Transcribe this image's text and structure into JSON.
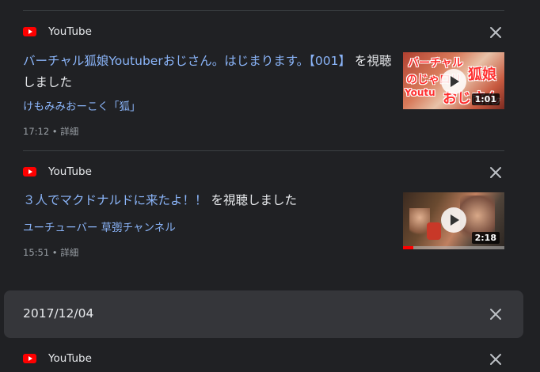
{
  "items": [
    {
      "source": "YouTube",
      "title_link": "バーチャル狐娘Youtuberおじさん。はじまります。【001】",
      "title_suffix": " を視聴しました",
      "channel": "けもみみおーこく「狐」",
      "time": "17:12",
      "separator": " • ",
      "detail_label": "詳細",
      "thumbnail": {
        "overlay_line1": "バーチャル",
        "overlay_line2": "のじゃロリ",
        "overlay_line3": "狐娘",
        "overlay_line4": "Youtu",
        "overlay_line5": "おじさん",
        "duration": "1:01"
      }
    },
    {
      "source": "YouTube",
      "title_link": "３人でマクドナルドに来たよ！！",
      "title_suffix": " を視聴しました",
      "channel": "ユーチューバー 草彅チャンネル",
      "time": "15:51",
      "separator": " • ",
      "detail_label": "詳細",
      "thumbnail": {
        "duration": "2:18",
        "watched_fraction": 0.1
      }
    }
  ],
  "date_group": {
    "date": "2017/12/04"
  },
  "next_item": {
    "source": "YouTube"
  },
  "icons": {
    "source_logo": "youtube-logo-icon",
    "close": "close-icon",
    "play": "play-icon"
  },
  "colors": {
    "background": "#202124",
    "link": "#8ab4f8",
    "text": "#e8eaed",
    "muted": "#9aa0a6",
    "date_header_bg": "#35363a",
    "youtube_red": "#ff0000"
  }
}
